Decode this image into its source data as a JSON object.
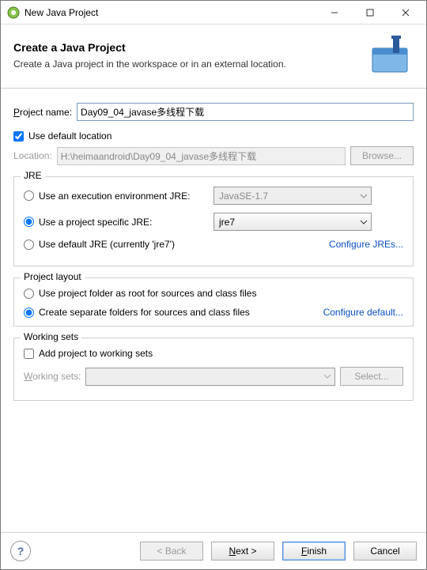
{
  "titlebar": {
    "title": "New Java Project"
  },
  "header": {
    "heading": "Create a Java Project",
    "subheading": "Create a Java project in the workspace or in an external location."
  },
  "project": {
    "name_label": "Project name:",
    "name_value": "Day09_04_javase多线程下载",
    "use_default_label": "Use default location",
    "location_label": "Location:",
    "location_value": "H:\\heimaandroid\\Day09_04_javase多线程下载",
    "browse_label": "Browse..."
  },
  "jre": {
    "legend": "JRE",
    "env_label": "Use an execution environment JRE:",
    "env_value": "JavaSE-1.7",
    "specific_label": "Use a project specific JRE:",
    "specific_value": "jre7",
    "default_label": "Use default JRE (currently 'jre7')",
    "configure_link": "Configure JREs..."
  },
  "layout": {
    "legend": "Project layout",
    "root_label": "Use project folder as root for sources and class files",
    "separate_label": "Create separate folders for sources and class files",
    "configure_link": "Configure default..."
  },
  "workingsets": {
    "legend": "Working sets",
    "add_label": "Add project to working sets",
    "sets_label": "Working sets:",
    "select_label": "Select..."
  },
  "footer": {
    "back": "< Back",
    "next": "Next >",
    "finish": "Finish",
    "cancel": "Cancel"
  }
}
